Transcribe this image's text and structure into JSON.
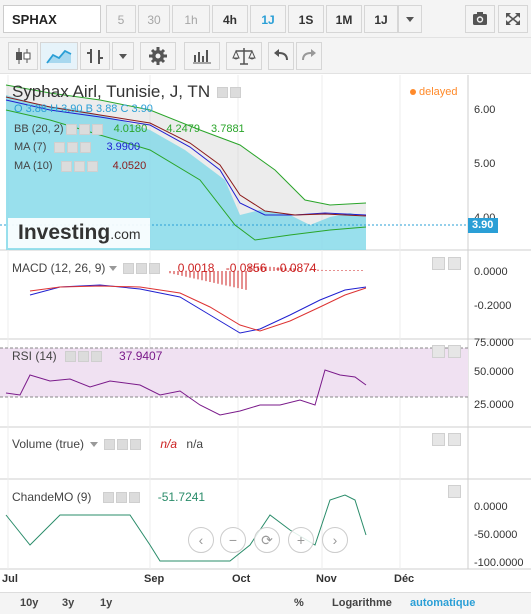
{
  "toolbar": {
    "symbol": "SPHAX",
    "timeframes": [
      {
        "label": "5",
        "state": "dim"
      },
      {
        "label": "30",
        "state": "dim"
      },
      {
        "label": "1h",
        "state": "dim"
      },
      {
        "label": "4h",
        "state": "normal"
      },
      {
        "label": "1J",
        "state": "active"
      },
      {
        "label": "1S",
        "state": "normal"
      },
      {
        "label": "1M",
        "state": "normal"
      },
      {
        "label": "1J",
        "state": "normal"
      }
    ]
  },
  "tools": [
    "candlestick-icon",
    "area-chart-icon",
    "bar-chart-icon",
    "gear-icon",
    "indicators-icon",
    "scales-icon",
    "undo-icon",
    "redo-icon"
  ],
  "price_pane": {
    "title": "Syphax Airl, Tunisie, J, TN",
    "status": "delayed",
    "ohlc": {
      "o_label": "O",
      "o": "3.88",
      "h_label": "H",
      "h": "3.90",
      "b_label": "B",
      "b": "3.88",
      "c_label": "C",
      "c": "3.90"
    },
    "bb": {
      "label": "BB (20, 2)",
      "v1": "4.0180",
      "v2": "4.2479",
      "v3": "3.7881"
    },
    "ma7": {
      "label": "MA (7)",
      "value": "3.9900"
    },
    "ma10": {
      "label": "MA (10)",
      "value": "4.0520"
    },
    "y_ticks": [
      "6.00",
      "5.00",
      "4.00"
    ],
    "last_price": "3.90",
    "watermark": "Investing",
    "watermark_suffix": ".com"
  },
  "macd_pane": {
    "label": "MACD (12, 26, 9)",
    "v1": "0.0018",
    "v2": "-0.0856",
    "v3": "-0.0874",
    "y_ticks": [
      "0.0000",
      "-0.2000"
    ]
  },
  "rsi_pane": {
    "label": "RSI (14)",
    "value": "37.9407",
    "y_ticks": [
      "75.0000",
      "50.0000",
      "25.0000"
    ]
  },
  "volume_pane": {
    "label": "Volume (true)",
    "v1": "n/a",
    "v2": "n/a"
  },
  "cmo_pane": {
    "label": "ChandeMO (9)",
    "value": "-51.7241",
    "y_ticks": [
      "0.0000",
      "-50.0000",
      "-100.0000"
    ]
  },
  "x_axis": [
    "Jul",
    "Sep",
    "Oct",
    "Nov",
    "Déc"
  ],
  "bottom_bar": {
    "periods": [
      "10y",
      "3y",
      "1y"
    ],
    "percent": "%",
    "log": "Logarithme",
    "auto": "automatique"
  },
  "colors": {
    "accent": "#2a9fd6",
    "ma7": "#2020d0",
    "ma10": "#8b1a1a",
    "bb": "#2aa52a",
    "area": "#7fd8e8",
    "macd_hist": "#cc2222",
    "rsi_band": "#f0e1f2",
    "rsi_line": "#7a1a8a",
    "cmo_line": "#2a8c6a"
  }
}
